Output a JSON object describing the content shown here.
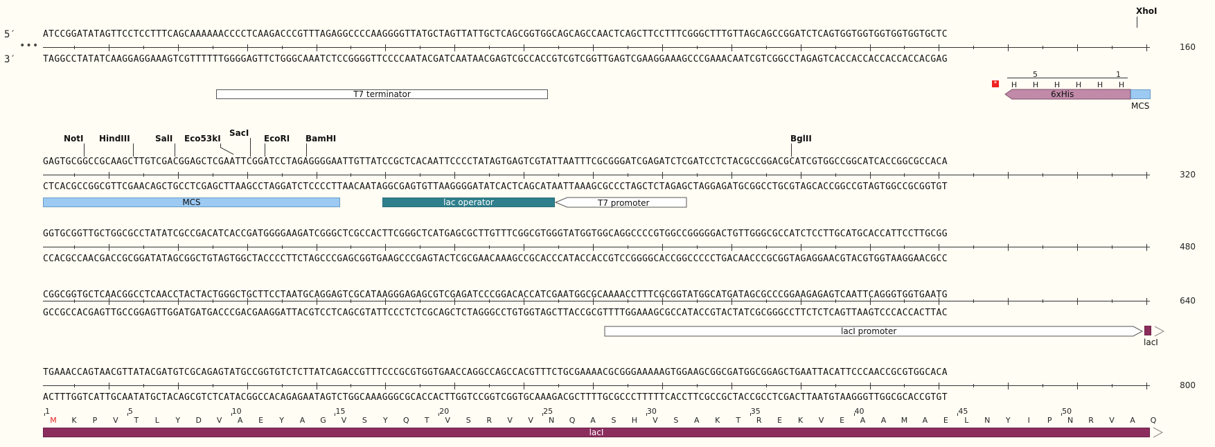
{
  "strands": {
    "five_prime": "5′",
    "three_prime": "3′",
    "more": "•••"
  },
  "rows": [
    {
      "top": "ATCCGGATATAGTTCCTCCTTTCAGCAAAAAACCCCTCAAGACCCGTTTAGAGGCCCCAAGGGGTTATGCTAGTTATTGCTCAGCGGTGGCAGCAGCCAACTCAGCTTCCTTTCGGGCTTTGTTAGCAGCCGGATCTCAGTGGTGGTGGTGGTGGTGCTC",
      "bottom": "TAGGCCTATATCAAGGAGGAAAGTCGTTTTTTGGGGAGTTCTGGGCAAATCTCCGGGGTTCCCCAATACGATCAATAACGAGTCGCCACCGTCGTCGGTTGAGTCGAAGGAAAGCCCGAAACAATCGTCGGCCTAGAGTCACCACCACCACCACCACGAG",
      "end": "160"
    },
    {
      "top": "GAGTGCGGCCGCAAGCTTGTCGACGGAGCTCGAATTCGGATCCTAGAGGGGAATTGTTATCCGCTCACAATTCCCCTATAGTGAGTCGTATTAATTTCGCGGGATCGAGATCTCGATCCTCTACGCCGGACGCATCGTGGCCGGCATCACCGGCGCCACA",
      "bottom": "CTCACGCCGGCGTTCGAACAGCTGCCTCGAGCTTAAGCCTAGGATCTCCCCTTAACAATAGGCGAGTGTTAAGGGGATATCACTCAGCATAATTAAAGCGCCCTAGCTCTAGAGCTAGGAGATGCGGCCTGCGTAGCACCGGCCGTAGTGGCCGCGGTGT",
      "end": "320"
    },
    {
      "top": "GGTGCGGTTGCTGGCGCCTATATCGCCGACATCACCGATGGGGAAGATCGGGCTCGCCACTTCGGGCTCATGAGCGCTTGTTTCGGCGTGGGTATGGTGGCAGGCCCCGTGGCCGGGGGACTGTTGGGCGCCATCTCCTTGCATGCACCATTCCTTGCGG",
      "bottom": "CCACGCCAACGACCGCGGATATAGCGGCTGTAGTGGCTACCCCTTCTAGCCCGAGCGGTGAAGCCCGAGTACTCGCGAACAAAGCCGCACCCATACCACCGTCCGGGGCACCGGCCCCCTGACAACCCGCGGTAGAGGAACGTACGTGGTAAGGAACGCC",
      "end": "480"
    },
    {
      "top": "CGGCGGTGCTCAACGGCCTCAACCTACTACTGGGCTGCTTCCTAATGCAGGAGTCGCATAAGGGAGAGCGTCGAGATCCCGGACACCATCGAATGGCGCAAAACCTTTCGCGGTATGGCATGATAGCGCCCGGAAGAGAGTCAATTCAGGGTGGTGAATG",
      "bottom": "GCCGCCACGAGTTGCCGGAGTTGGATGATGACCCGACGAAGGATTACGTCCTCAGCGTATTCCCTCTCGCAGCTCTAGGGCCTGTGGTAGCTTACCGCGTTTTGGAAAGCGCCATACCGTACTATCGCGGGCCTTCTCTCAGTTAAGTCCCACCACTTAC",
      "end": "640"
    },
    {
      "top": "TGAAACCAGTAACGTTATACGATGTCGCAGAGTATGCCGGTGTCTCTTATCAGACCGTTTCCCGCGTGGTGAACCAGGCCAGCCACGTTTCTGCGAAAACGCGGGAAAAAGTGGAAGCGGCGATGGCGGAGCTGAATTACATTCCCAACCGCGTGGCACA",
      "bottom": "ACTTTGGTCATTGCAATATGCTACAGCGTCTCATACGGCCACAGAGAATAGTCTGGCAAAGGGCGCACCACTTGGTCCGGTCGGTGCAAAGACGCTTTTGCGCCCTTTTTCACCTTCGCCGCTACCGCCTCGACTTAATGTAAGGGTTGGCGCACCGTGT",
      "end": "800"
    }
  ],
  "sites": {
    "xhoi": "XhoI",
    "noti": "NotI",
    "hindiii": "HindIII",
    "sali": "SalI",
    "eco53ki": "Eco53kI",
    "saci": "SacI",
    "ecori": "EcoRI",
    "bamhi": "BamHI",
    "bglii": "BglII"
  },
  "features": {
    "t7_terminator": "T7 terminator",
    "his": "6xHis",
    "mcs": "MCS",
    "lac_operator": "lac operator",
    "t7_promoter": "T7 promoter",
    "laci_promoter": "lacI promoter",
    "laci": "lacI"
  },
  "his_track": {
    "residues": [
      "H",
      "H",
      "H",
      "H",
      "H",
      "H"
    ],
    "num_5": "5",
    "num_1": "1",
    "stop": "*"
  },
  "laci_translation": {
    "residues": [
      "M",
      "K",
      "P",
      "V",
      "T",
      "L",
      "Y",
      "D",
      "V",
      "A",
      "E",
      "Y",
      "A",
      "G",
      "V",
      "S",
      "Y",
      "Q",
      "T",
      "V",
      "S",
      "R",
      "V",
      "V",
      "N",
      "Q",
      "A",
      "S",
      "H",
      "V",
      "S",
      "A",
      "K",
      "T",
      "R",
      "E",
      "K",
      "V",
      "E",
      "A",
      "A",
      "M",
      "A",
      "E",
      "L",
      "N",
      "Y",
      "I",
      "P",
      "N",
      "R",
      "V",
      "A",
      "Q"
    ],
    "numbers": [
      "1",
      "5",
      "10",
      "15",
      "20",
      "25",
      "30",
      "35",
      "40",
      "45",
      "50"
    ]
  },
  "colors": {
    "mcs": "#9ccaf3",
    "lac_operator": "#2f7f8c",
    "his": "#c08aa8",
    "laci": "#8b2e5e",
    "start_codon": "#e22222"
  }
}
